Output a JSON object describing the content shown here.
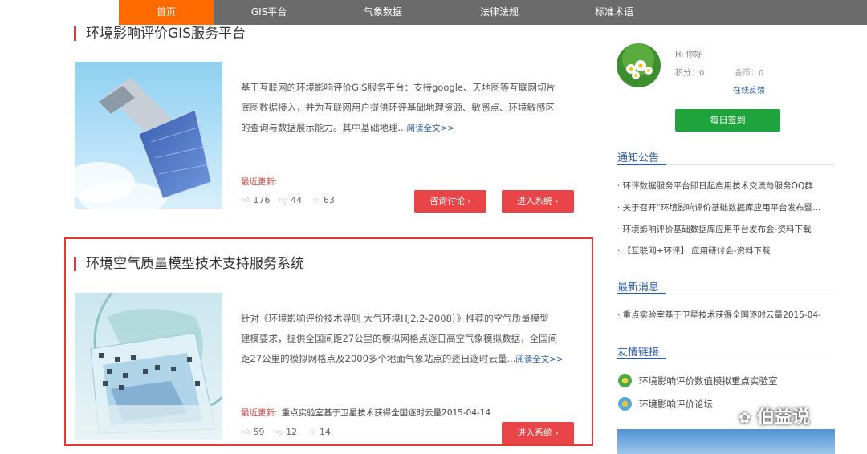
{
  "nav": {
    "items": [
      {
        "label": "首页"
      },
      {
        "label": "GIS平台"
      },
      {
        "label": "气象数据"
      },
      {
        "label": "法律法规"
      },
      {
        "label": "标准术语"
      }
    ]
  },
  "cards": [
    {
      "title": "环境影响评价GIS服务平台",
      "desc_lines": [
        "基于互联网的环境影响评价GIS服务平台：支持google、天地图等互联网切片",
        "底图数据接入，并为互联网用户提供环评基础地理资源、敏感点、环境敏感区",
        "的查询与数据展示能力。其中基础地理..."
      ],
      "read_more": "阅读全文>>",
      "update_label": "最近更新:",
      "update_text": "",
      "likes": "176",
      "dislikes": "44",
      "stars": "63",
      "consult_btn": "咨询讨论 ›",
      "enter_btn": "进入系统 ›"
    },
    {
      "title": "环境空气质量模型技术支持服务系统",
      "desc_lines": [
        "针对《环境影响评价技术导则  大气环境HJ2.2-2008）》推荐的空气质量模型",
        "建模要求，提供全国间距27公里的模拟网格点逐日高空气象模拟数据，全国间",
        "距27公里的模拟网格点及2000多个地面气象站点的逐日逐时云量..."
      ],
      "read_more": "阅读全文>>",
      "update_label": "最近更新:",
      "update_text": "重点实验室基于卫星技术获得全国逐时云量2015-04-14",
      "likes": "59",
      "dislikes": "12",
      "stars": "14",
      "enter_btn": "进入系统 ›"
    }
  ],
  "user": {
    "greeting": "Hi 你好",
    "points": "积分：0",
    "coins": "金币：0",
    "feedback": "在线反馈",
    "sign_btn": "每日签到"
  },
  "notices": {
    "title": "通知公告",
    "items": [
      "· 环评数据服务平台即日起启用技术交流与服务QQ群",
      "· 关于召开“环境影响评价基础数据库应用平台发布暨...",
      "· 环境影响评价基础数据库应用平台发布会-资料下载",
      "· 【互联网+环评】 应用研讨会-资料下载"
    ]
  },
  "news": {
    "title": "最新消息",
    "items": [
      "· 重点实验室基于卫星技术获得全国逐时云量2015-04-"
    ]
  },
  "links": {
    "title": "友情链接",
    "items": [
      "环境影响评价数值模拟重点实验室",
      "环境影响评价论坛"
    ]
  },
  "watermark": "伯益说",
  "colors": {
    "accent": "#ff6a00",
    "red": "#e94447",
    "green": "#1fa33c",
    "blue": "#2a5ea8"
  }
}
